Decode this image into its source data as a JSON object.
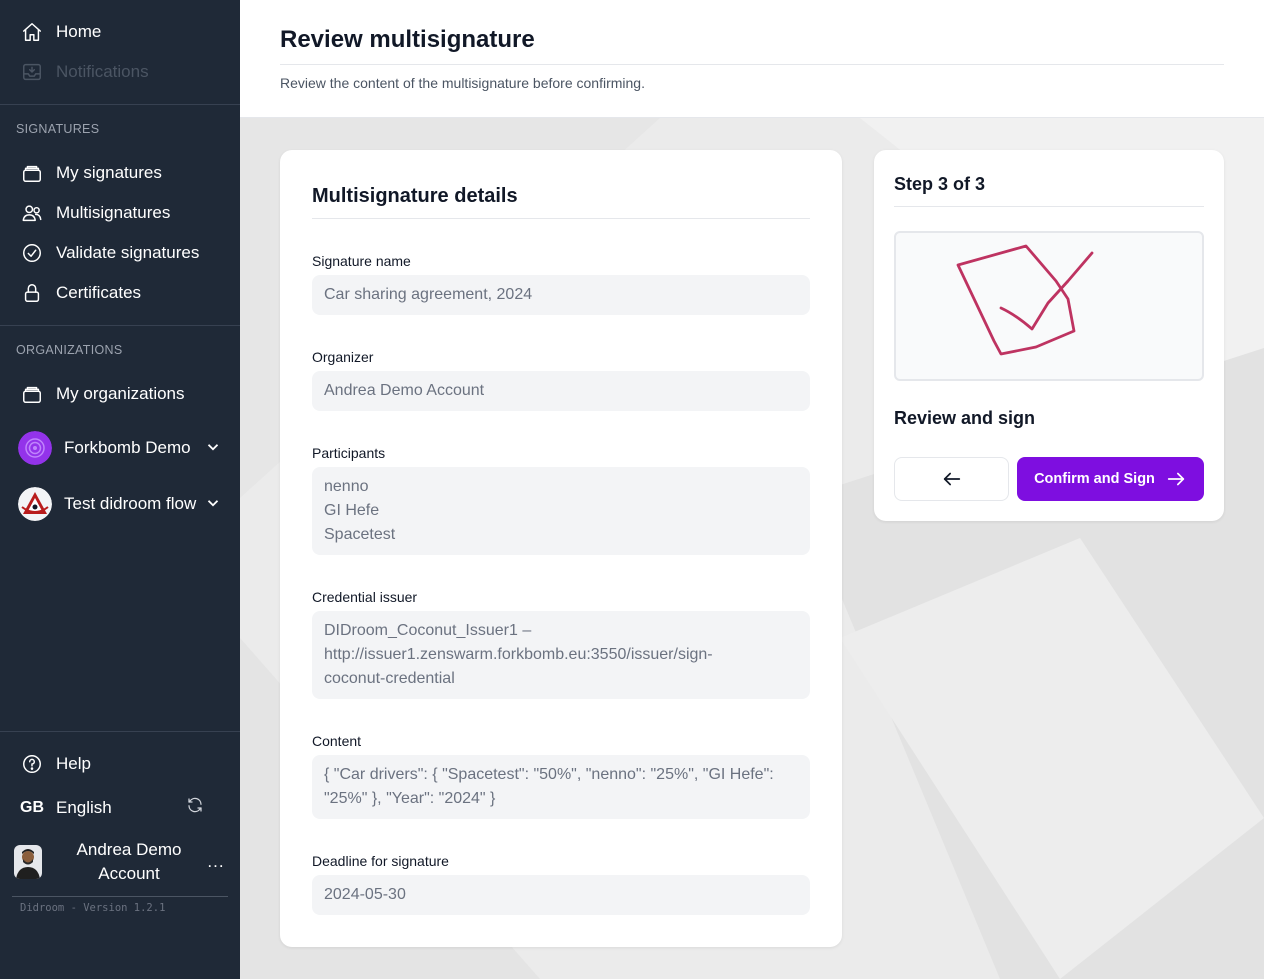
{
  "sidebar": {
    "top_items": [
      {
        "label": "Home",
        "icon": "home-icon"
      },
      {
        "label": "Notifications",
        "icon": "inbox-icon",
        "disabled": true
      }
    ],
    "signatures_section": "SIGNATURES",
    "signature_items": [
      {
        "label": "My signatures",
        "icon": "stack-icon"
      },
      {
        "label": "Multisignatures",
        "icon": "users-icon"
      },
      {
        "label": "Validate signatures",
        "icon": "check-circle-icon"
      },
      {
        "label": "Certificates",
        "icon": "lock-icon"
      }
    ],
    "organizations_section": "ORGANIZATIONS",
    "my_organizations": "My organizations",
    "orgs": [
      {
        "label": "Forkbomb Demo",
        "avatar_color": "#9333ea"
      },
      {
        "label": "Test didroom flow",
        "avatar_color": "#b91c1c"
      }
    ],
    "help": "Help",
    "language_code": "GB",
    "language": "English",
    "user_name_line1": "Andrea Demo",
    "user_name_line2": "Account",
    "user_menu": "...",
    "version": "Didroom - Version 1.2.1"
  },
  "header": {
    "title": "Review multisignature",
    "subtitle": "Review the content of the multisignature before confirming."
  },
  "details": {
    "title": "Multisignature details",
    "signature_name_label": "Signature name",
    "signature_name": "Car sharing agreement, 2024",
    "organizer_label": "Organizer",
    "organizer": "Andrea Demo Account",
    "participants_label": "Participants",
    "participants": [
      "nenno",
      "GI Hefe",
      "Spacetest"
    ],
    "credential_issuer_label": "Credential issuer",
    "credential_issuer_line1": "DIDroom_Coconut_Issuer1 –",
    "credential_issuer_line2": "http://issuer1.zenswarm.forkbomb.eu:3550/issuer/sign-",
    "credential_issuer_line3": "coconut-credential",
    "content_label": "Content",
    "content_line1": "{ \"Car drivers\": { \"Spacetest\": \"50%\", \"nenno\": \"25%\", \"GI Hefe\":",
    "content_line2": "\"25%\" }, \"Year\": \"2024\" }",
    "deadline_label": "Deadline for signature",
    "deadline": "2024-05-30"
  },
  "step": {
    "title": "Step 3 of 3",
    "review_title": "Review and sign",
    "confirm_label": "Confirm and Sign",
    "signature_stroke_color": "#be3361"
  },
  "colors": {
    "sidebar_bg": "#1f2937",
    "accent": "#7e0ee0"
  }
}
